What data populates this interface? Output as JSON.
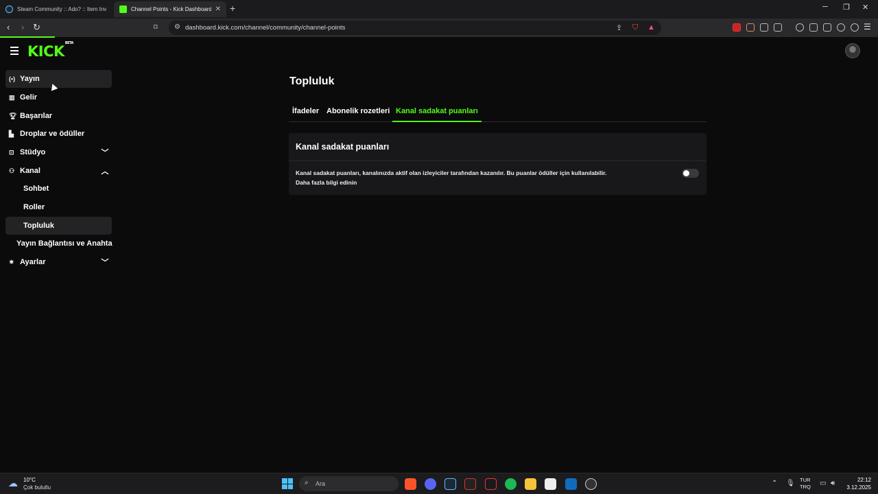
{
  "browser": {
    "tabs": [
      {
        "title": "Steam Community :: Ado? :: Item Inve",
        "active": false
      },
      {
        "title": "Channel Points - Kick Dashboard",
        "active": true
      }
    ],
    "url": "dashboard.kick.com/channel/community/channel-points"
  },
  "header": {
    "logo": "KICK",
    "logo_badge": "BETA"
  },
  "sidebar": {
    "items": [
      {
        "label": "Yayın",
        "icon": "broadcast-icon"
      },
      {
        "label": "Gelir",
        "icon": "revenue-icon"
      },
      {
        "label": "Başarılar",
        "icon": "trophy-icon"
      },
      {
        "label": "Droplar ve ödüller",
        "icon": "drops-icon"
      },
      {
        "label": "Stüdyo",
        "icon": "studio-icon"
      },
      {
        "label": "Kanal",
        "icon": "channel-icon"
      },
      {
        "label": "Sohbet"
      },
      {
        "label": "Roller"
      },
      {
        "label": "Topluluk"
      },
      {
        "label": "Yayın Bağlantısı ve Anahtarı"
      },
      {
        "label": "Ayarlar",
        "icon": "gear-icon"
      }
    ]
  },
  "main": {
    "title": "Topluluk",
    "tabs": [
      {
        "label": "İfadeler"
      },
      {
        "label": "Abonelik rozetleri"
      },
      {
        "label": "Kanal sadakat puanları"
      }
    ],
    "card": {
      "title": "Kanal sadakat puanları",
      "description": "Kanal sadakat puanları, kanalınızda aktif olan izleyiciler tarafından kazanılır. Bu puanlar ödüller için kullanılabilir.",
      "link": "Daha fazla bilgi edinin",
      "toggle_on": false
    }
  },
  "taskbar": {
    "weather_temp": "10°C",
    "weather_desc": "Çok bulutlu",
    "search_placeholder": "Ara",
    "lang_top": "TUR",
    "lang_bottom": "TRQ",
    "time": "22:12",
    "date": "3.12.2025"
  },
  "colors": {
    "accent": "#53fc18",
    "background": "#0b0b0c",
    "card": "#18181a"
  }
}
